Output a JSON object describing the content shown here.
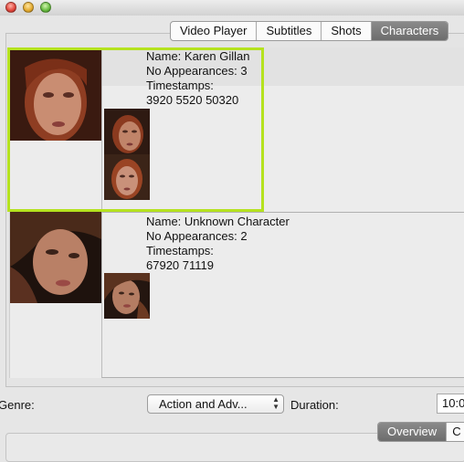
{
  "window": {
    "controls": [
      "close",
      "minimize",
      "zoom"
    ]
  },
  "tabs": [
    {
      "label": "Video Player",
      "active": false
    },
    {
      "label": "Subtitles",
      "active": false
    },
    {
      "label": "Shots",
      "active": false
    },
    {
      "label": "Characters",
      "active": true
    }
  ],
  "characters": [
    {
      "name": "Name: Karen Gillan",
      "appearances": "No Appearances: 3",
      "timestamps_label": "Timestamps:",
      "timestamps": "3920 5520 50320",
      "selected": true,
      "thumbnail_count": 2
    },
    {
      "name": "Name: Unknown Character",
      "appearances": "No Appearances: 2",
      "timestamps_label": "Timestamps:",
      "timestamps": "67920 71119",
      "selected": false,
      "thumbnail_count": 1
    }
  ],
  "footer": {
    "genre_label": "Genre:",
    "genre_value": "Action and Adv...",
    "duration_label": "Duration:",
    "duration_value": "10:0",
    "bottom_tabs": [
      {
        "label": "Overview",
        "active": true
      },
      {
        "label": "C",
        "active": false
      }
    ]
  },
  "colors": {
    "selection": "#b5e21f",
    "active_tab": "#7a7a7a"
  }
}
